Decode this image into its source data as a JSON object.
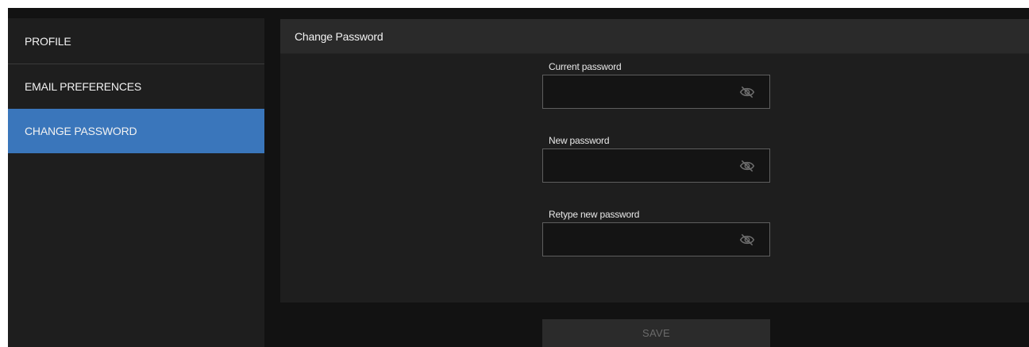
{
  "sidebar": {
    "items": [
      {
        "label": "PROFILE"
      },
      {
        "label": "EMAIL PREFERENCES"
      },
      {
        "label": "CHANGE PASSWORD",
        "active": true
      }
    ]
  },
  "main": {
    "title": "Change Password",
    "fields": [
      {
        "label": "Current password",
        "value": "",
        "icon": "eye-slash-icon"
      },
      {
        "label": "New password",
        "value": "",
        "icon": "eye-slash-icon"
      },
      {
        "label": "Retype new password",
        "value": "",
        "icon": "eye-slash-icon"
      }
    ],
    "save_label": "SAVE"
  },
  "colors": {
    "accent": "#3a76bb",
    "background": "#121212",
    "panel": "#1e1e1e",
    "header": "#2a2a2a"
  }
}
